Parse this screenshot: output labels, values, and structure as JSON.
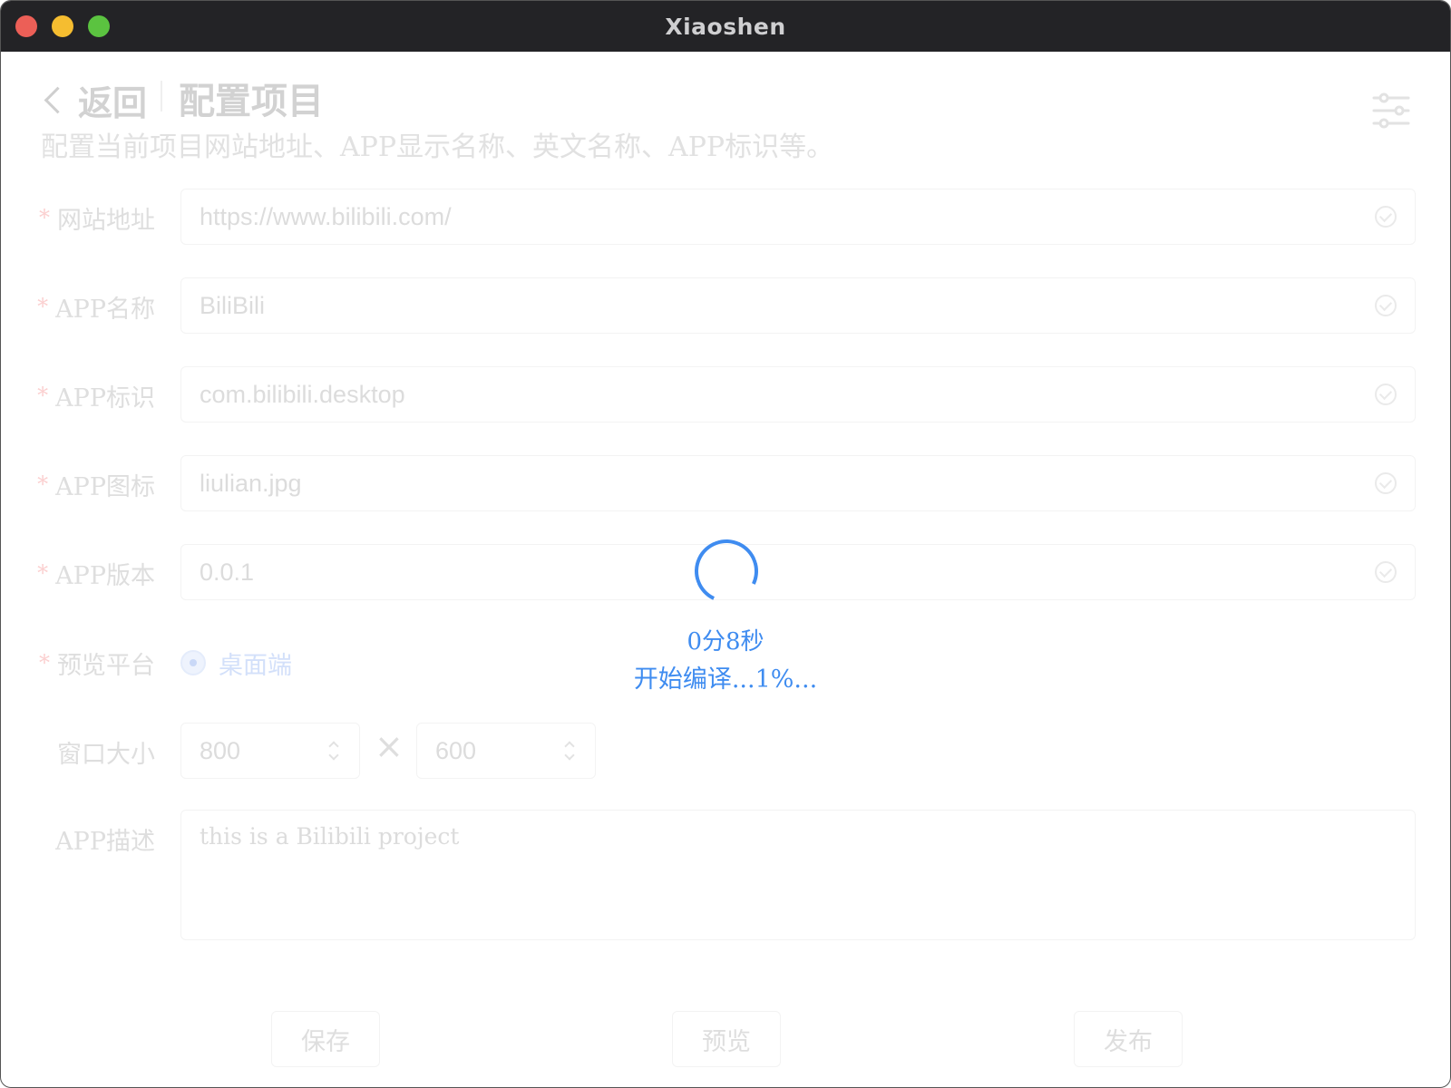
{
  "window": {
    "title": "Xiaoshen"
  },
  "header": {
    "back_label": "返回",
    "title": "配置项目",
    "description": "配置当前项目网站地址、APP显示名称、英文名称、APP标识等。"
  },
  "form": {
    "required_mark": "*",
    "fields": [
      {
        "label": "网站地址",
        "value": "https://www.bilibili.com/"
      },
      {
        "label": "APP名称",
        "value": "BiliBili"
      },
      {
        "label": "APP标识",
        "value": "com.bilibili.desktop"
      },
      {
        "label": "APP图标",
        "value": "liulian.jpg"
      },
      {
        "label": "APP版本",
        "value": "0.0.1"
      }
    ],
    "platform": {
      "label": "预览平台",
      "option": "桌面端"
    },
    "window_size": {
      "label": "窗口大小",
      "width": "800",
      "height": "600",
      "separator": "×"
    },
    "description": {
      "label": "APP描述",
      "value": "this is a Bilibili project"
    }
  },
  "actions": {
    "save": "保存",
    "preview": "预览",
    "publish": "发布"
  },
  "loading": {
    "elapsed": "0分8秒",
    "status": "开始编译...1%...",
    "accent_color": "#3f8cf0"
  },
  "icons": [
    "chevron-left-icon",
    "settings-sliders-icon",
    "check-circle-icon",
    "spinner-icon"
  ]
}
